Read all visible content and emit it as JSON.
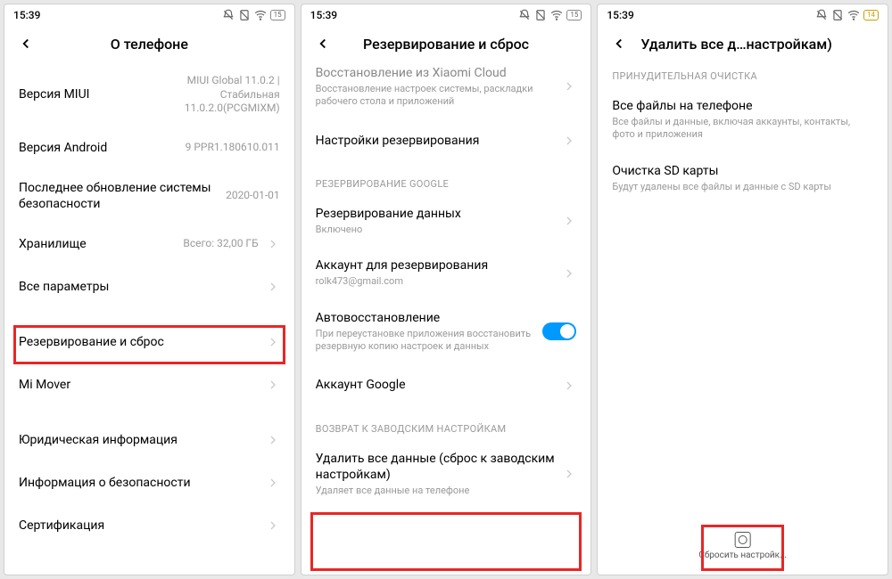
{
  "status": {
    "time": "15:39",
    "battery1": "15",
    "battery2": "15",
    "battery3": "14"
  },
  "screen1": {
    "title": "О телефоне",
    "rows": {
      "miui": {
        "label": "Версия MIUI",
        "value": "MIUI Global 11.0.2 | Стабильная 11.0.2.0(PCGMIXM)"
      },
      "android": {
        "label": "Версия Android",
        "value": "9 PPR1.180610.011"
      },
      "security": {
        "label": "Последнее обновление системы безопасности",
        "value": "2020-01-01"
      },
      "storage": {
        "label": "Хранилище",
        "value": "Всего: 32,00 ГБ"
      },
      "allparams": {
        "label": "Все параметры"
      },
      "backup": {
        "label": "Резервирование и сброс"
      },
      "mimover": {
        "label": "Mi Mover"
      },
      "legal": {
        "label": "Юридическая информация"
      },
      "secinfo": {
        "label": "Информация о безопасности"
      },
      "cert": {
        "label": "Сертификация"
      }
    }
  },
  "screen2": {
    "title": "Резервирование и сброс",
    "rows": {
      "xiaomi": {
        "label": "Восстановление из Xiaomi Cloud",
        "sub": "Восстановление настроек системы, раскладки рабочего стола и приложений"
      },
      "backupset": {
        "label": "Настройки резервирования"
      },
      "section_google": "РЕЗЕРВИРОВАНИЕ GOOGLE",
      "datacopy": {
        "label": "Резервирование данных",
        "sub": "Включено"
      },
      "account": {
        "label": "Аккаунт для резервирования",
        "sub": "rolk473@gmail.com"
      },
      "autorestore": {
        "label": "Автовосстановление",
        "sub": "При переустановке приложения восстановить резервную копию настроек и данных"
      },
      "googleacc": {
        "label": "Аккаунт Google"
      },
      "section_factory": "ВОЗВРАТ К ЗАВОДСКИМ НАСТРОЙКАМ",
      "deleteall": {
        "label": "Удалить все данные (сброс к заводским настройкам)",
        "sub": "Удаляет все данные на телефоне"
      }
    }
  },
  "screen3": {
    "title": "Удалить все д…настройкам)",
    "section_force": "ПРИНУДИТЕЛЬНАЯ ОЧИСТКА",
    "rows": {
      "allfiles": {
        "label": "Все файлы на телефоне",
        "sub": "Все файлы и данные, включая аккаунты, контакты, фото и приложения"
      },
      "sdcard": {
        "label": "Очистка SD карты",
        "sub": "Будут удалены все файлы и данные с SD карты"
      }
    },
    "button": "Сбросить настройк..."
  }
}
